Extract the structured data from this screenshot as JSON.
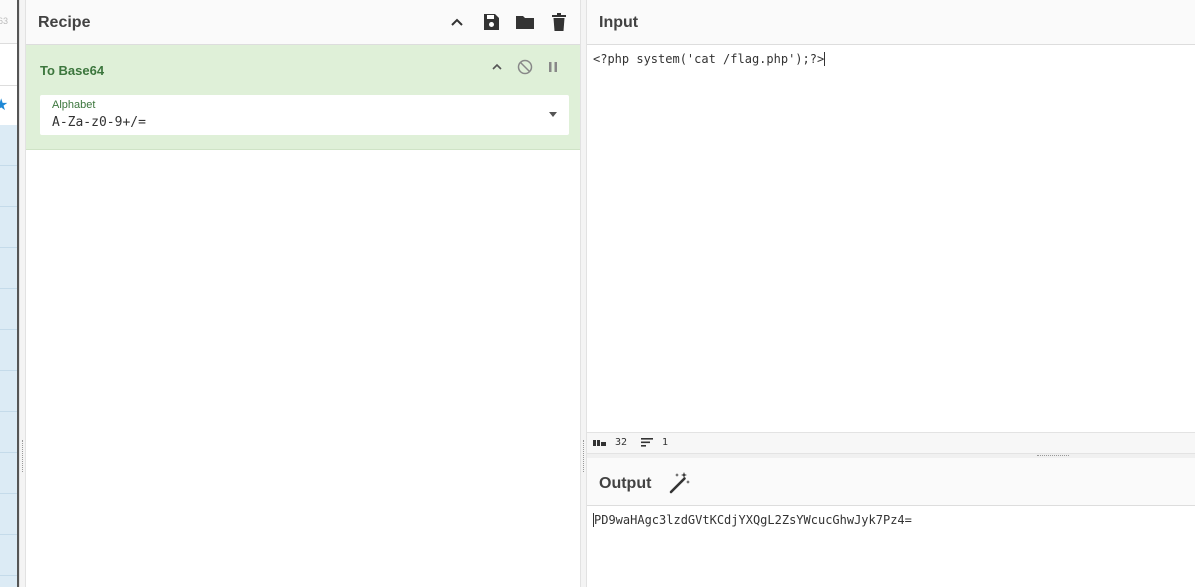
{
  "operations_pane": {
    "count_label": "63"
  },
  "recipe": {
    "title": "Recipe",
    "operation": {
      "name": "To Base64",
      "alphabet_label": "Alphabet",
      "alphabet_value": "A-Za-z0-9+/="
    }
  },
  "input": {
    "title": "Input",
    "text": "<?php system('cat /flag.php');?>",
    "status": {
      "length": "32",
      "lines": "1"
    }
  },
  "output": {
    "title": "Output",
    "text": "PD9waHAgc3lzdGVtKCdjYXQgL2ZsYWcucGhwJyk7Pz4="
  },
  "icons": {
    "collapse": "chevron-up-icon",
    "save": "save-icon",
    "load": "folder-icon",
    "clear": "trash-icon",
    "disable": "disable-icon",
    "breakpoint": "pause-icon",
    "length": "abc-icon",
    "lines": "lines-icon",
    "magic": "magic-wand-icon"
  },
  "colors": {
    "op_background": "#dff0d8",
    "op_text": "#3c763d",
    "ops_list": "#dcebf5"
  }
}
